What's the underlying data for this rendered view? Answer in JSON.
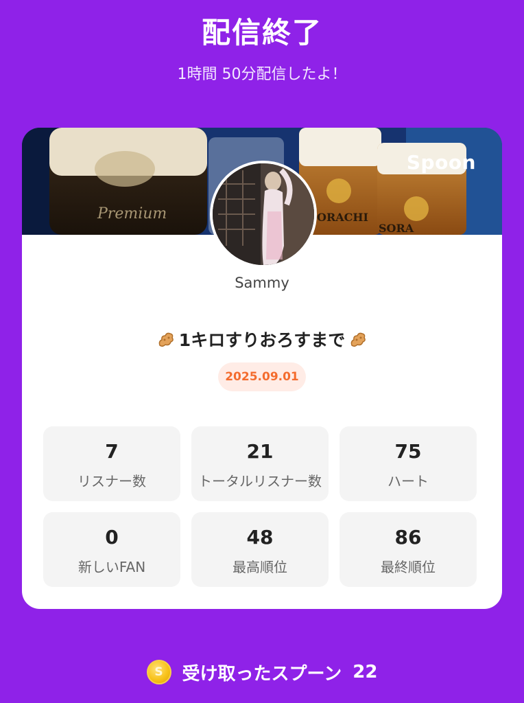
{
  "header": {
    "title": "配信終了",
    "subtitle": "1時間 50分配信したよ！"
  },
  "card": {
    "brand_logo": "Spoon",
    "username": "Sammy",
    "live_title": "1キロすりおろすまで",
    "title_decor_icon": "ginger-icon",
    "date": "2025.09.01",
    "stats": [
      {
        "value": "7",
        "label": "リスナー数"
      },
      {
        "value": "21",
        "label": "トータルリスナー数"
      },
      {
        "value": "75",
        "label": "ハート"
      },
      {
        "value": "0",
        "label": "新しいFAN"
      },
      {
        "value": "48",
        "label": "最高順位"
      },
      {
        "value": "86",
        "label": "最終順位"
      }
    ]
  },
  "footer": {
    "coin_icon": "spoon-coin-icon",
    "coin_symbol": "S",
    "label": "受け取ったスプーン",
    "count": "22"
  },
  "colors": {
    "background": "#8f22e8",
    "card": "#ffffff",
    "stat_tile": "#f4f4f4",
    "date_pill_bg": "#ffece6",
    "date_pill_text": "#f46c2e"
  }
}
